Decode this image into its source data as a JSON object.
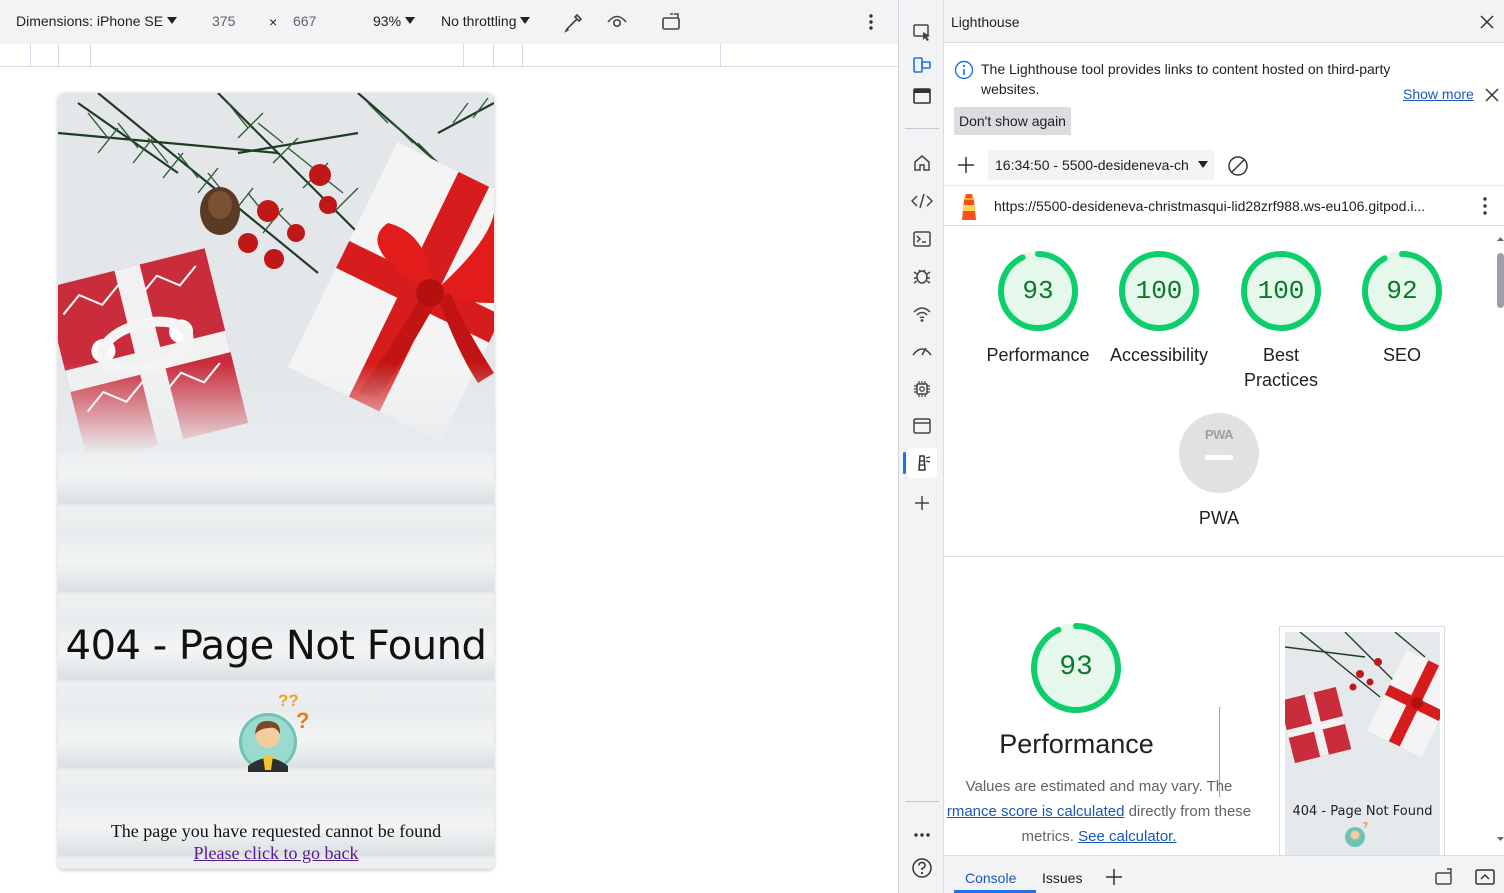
{
  "device_toolbar": {
    "dimensions_label": "Dimensions: iPhone SE",
    "width": "375",
    "times": "×",
    "height": "667",
    "zoom": "93%",
    "throttling": "No throttling"
  },
  "page": {
    "title": "404 - Page Not Found",
    "message": "The page you have requested cannot be found",
    "link": "Please click to go back"
  },
  "panel": {
    "title": "Lighthouse",
    "info_text": "The Lighthouse tool provides links to content hosted on third-party websites.",
    "show_more": "Show more",
    "dont_show": "Don't show again",
    "report_select": "16:34:50 - 5500-desideneva-ch",
    "report_url": "https://5500-desideneva-christmasqui-lid28zrf988.ws-eu106.gitpod.i..."
  },
  "scores": [
    {
      "value": "93",
      "label": "Performance",
      "score": 93
    },
    {
      "value": "100",
      "label": "Accessibility",
      "score": 100
    },
    {
      "value": "100",
      "label": "Best Practices",
      "score": 100
    },
    {
      "value": "92",
      "label": "SEO",
      "score": 92
    }
  ],
  "pwa": {
    "badge": "PWA",
    "label": "PWA"
  },
  "performance_section": {
    "score": "93",
    "score_value": 93,
    "title": "Performance",
    "desc_1": "Values are estimated and may vary. The",
    "desc_link_1": "rmance score is calculated",
    "desc_2": " directly from these",
    "desc_3": "metrics. ",
    "desc_link_2": "See calculator.",
    "thumb_caption": "404 - Page Not Found"
  },
  "drawer": {
    "tab_console": "Console",
    "tab_issues": "Issues"
  },
  "colors": {
    "pass_green": "#0cce6b",
    "pass_text": "#0a7a2a",
    "pass_fill": "#e6f8ec",
    "accent_blue": "#1a73e8"
  }
}
